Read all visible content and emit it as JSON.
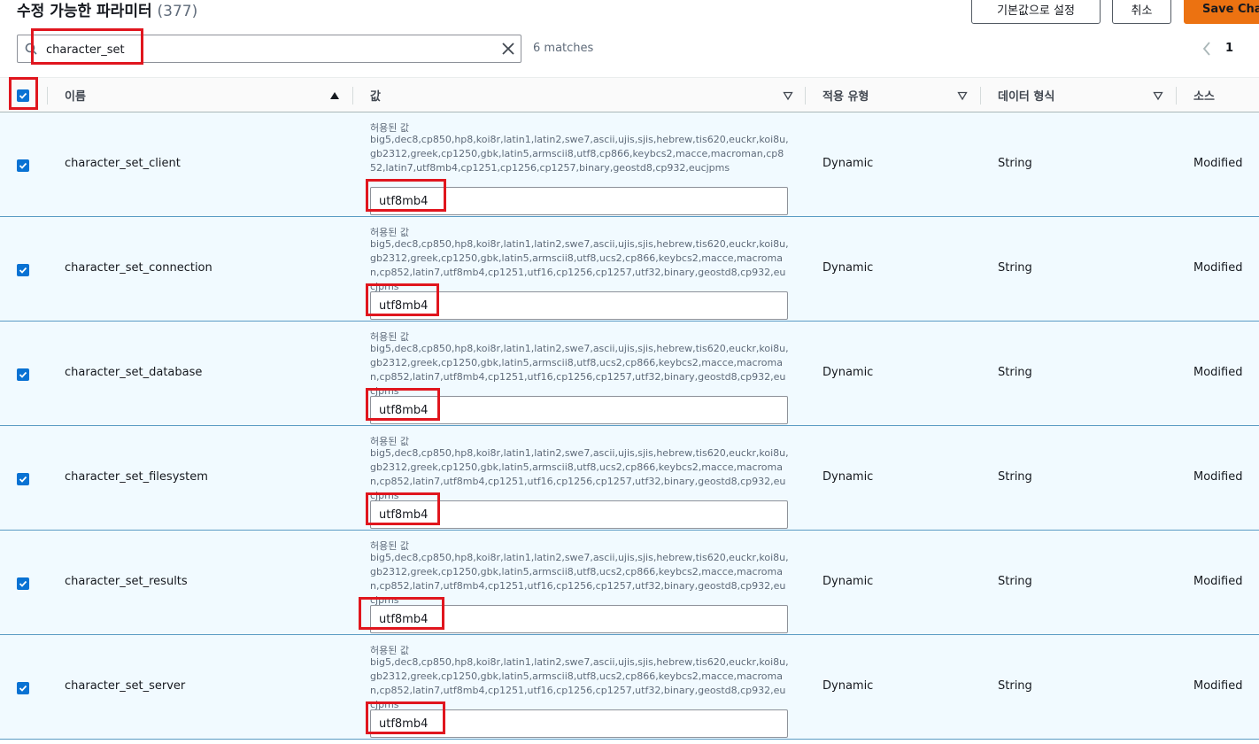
{
  "header": {
    "title": "수정 가능한 파라미터",
    "count": "(377)",
    "reset_label": "기본값으로 설정",
    "cancel_label": "취소",
    "save_label": "Save Changes"
  },
  "search": {
    "value": "character_set",
    "match_text": "6 matches"
  },
  "pagination": {
    "current_page": "1"
  },
  "columns": {
    "name": "이름",
    "value": "값",
    "apply_type": "적용 유형",
    "data_type": "데이터 형식",
    "source": "소스"
  },
  "rows": [
    {
      "name": "character_set_client",
      "allowed_label": "허용된 값",
      "allowed_values": "big5,dec8,cp850,hp8,koi8r,latin1,latin2,swe7,ascii,ujis,sjis,hebrew,tis620,euckr,koi8u,gb2312,greek,cp1250,gbk,latin5,armscii8,utf8,cp866,keybcs2,macce,macroman,cp852,latin7,utf8mb4,cp1251,cp1256,cp1257,binary,geostd8,cp932,eucjpms",
      "value": "utf8mb4",
      "apply_type": "Dynamic",
      "data_type": "String",
      "source": "Modified",
      "checked": true
    },
    {
      "name": "character_set_connection",
      "allowed_label": "허용된 값",
      "allowed_values": "big5,dec8,cp850,hp8,koi8r,latin1,latin2,swe7,ascii,ujis,sjis,hebrew,tis620,euckr,koi8u,gb2312,greek,cp1250,gbk,latin5,armscii8,utf8,ucs2,cp866,keybcs2,macce,macroman,cp852,latin7,utf8mb4,cp1251,utf16,cp1256,cp1257,utf32,binary,geostd8,cp932,eucjpms",
      "value": "utf8mb4",
      "apply_type": "Dynamic",
      "data_type": "String",
      "source": "Modified",
      "checked": true
    },
    {
      "name": "character_set_database",
      "allowed_label": "허용된 값",
      "allowed_values": "big5,dec8,cp850,hp8,koi8r,latin1,latin2,swe7,ascii,ujis,sjis,hebrew,tis620,euckr,koi8u,gb2312,greek,cp1250,gbk,latin5,armscii8,utf8,ucs2,cp866,keybcs2,macce,macroman,cp852,latin7,utf8mb4,cp1251,utf16,cp1256,cp1257,utf32,binary,geostd8,cp932,eucjpms",
      "value": "utf8mb4",
      "apply_type": "Dynamic",
      "data_type": "String",
      "source": "Modified",
      "checked": true
    },
    {
      "name": "character_set_filesystem",
      "allowed_label": "허용된 값",
      "allowed_values": "big5,dec8,cp850,hp8,koi8r,latin1,latin2,swe7,ascii,ujis,sjis,hebrew,tis620,euckr,koi8u,gb2312,greek,cp1250,gbk,latin5,armscii8,utf8,ucs2,cp866,keybcs2,macce,macroman,cp852,latin7,utf8mb4,cp1251,utf16,cp1256,cp1257,utf32,binary,geostd8,cp932,eucjpms",
      "value": "utf8mb4",
      "apply_type": "Dynamic",
      "data_type": "String",
      "source": "Modified",
      "checked": true
    },
    {
      "name": "character_set_results",
      "allowed_label": "허용된 값",
      "allowed_values": "big5,dec8,cp850,hp8,koi8r,latin1,latin2,swe7,ascii,ujis,sjis,hebrew,tis620,euckr,koi8u,gb2312,greek,cp1250,gbk,latin5,armscii8,utf8,ucs2,cp866,keybcs2,macce,macroman,cp852,latin7,utf8mb4,cp1251,utf16,cp1256,cp1257,utf32,binary,geostd8,cp932,eucjpms",
      "value": "utf8mb4",
      "apply_type": "Dynamic",
      "data_type": "String",
      "source": "Modified",
      "checked": true
    },
    {
      "name": "character_set_server",
      "allowed_label": "허용된 값",
      "allowed_values": "big5,dec8,cp850,hp8,koi8r,latin1,latin2,swe7,ascii,ujis,sjis,hebrew,tis620,euckr,koi8u,gb2312,greek,cp1250,gbk,latin5,armscii8,utf8,ucs2,cp866,keybcs2,macce,macroman,cp852,latin7,utf8mb4,cp1251,utf16,cp1256,cp1257,utf32,binary,geostd8,cp932,eucjpms",
      "value": "utf8mb4",
      "apply_type": "Dynamic",
      "data_type": "String",
      "source": "Modified",
      "checked": true
    }
  ],
  "colors": {
    "accent": "#0972d3",
    "save_button": "#ec7211",
    "highlight": "#e0161e",
    "selected_row": "#f1faff"
  }
}
